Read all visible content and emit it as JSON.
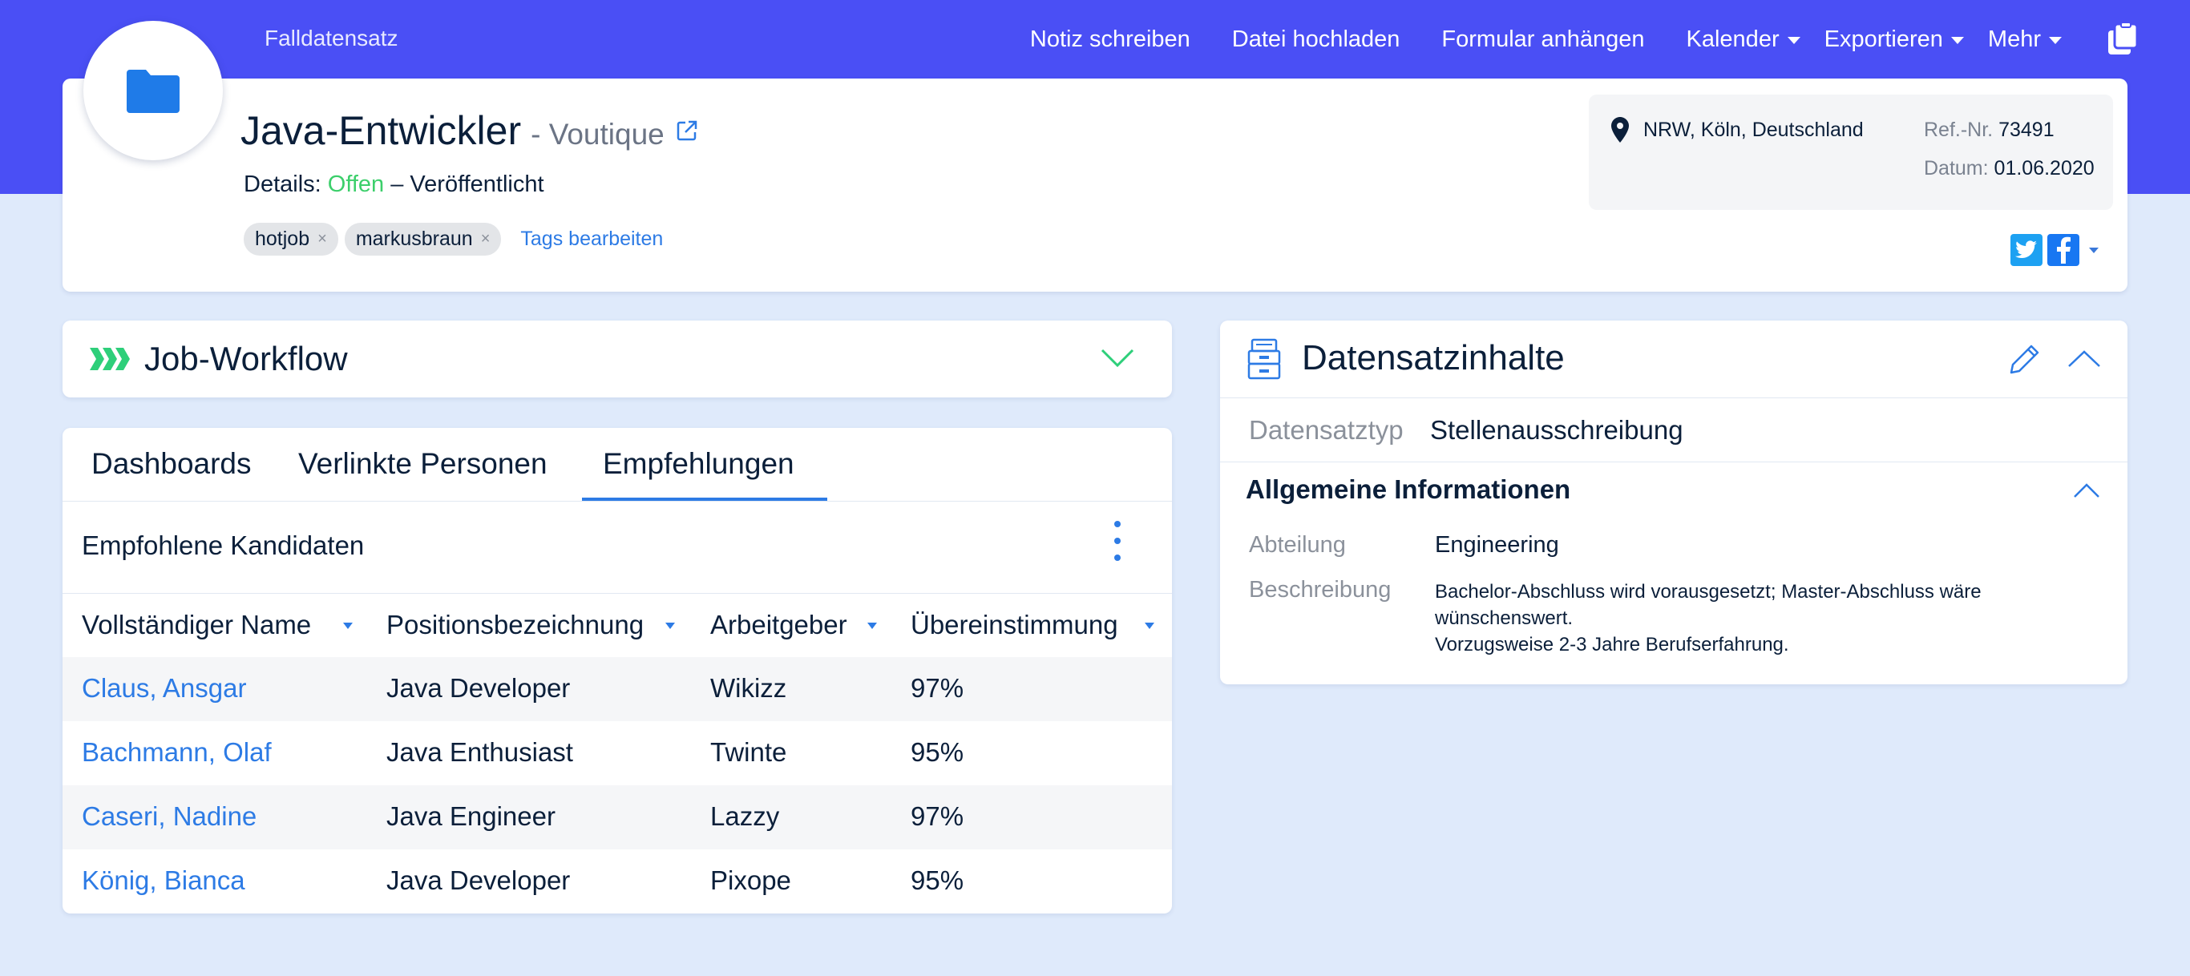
{
  "topbar": {
    "section_label": "Falldatensatz",
    "links": {
      "note": "Notiz schreiben",
      "upload": "Datei hochladen",
      "form": "Formular anhängen",
      "calendar": "Kalender",
      "export": "Exportieren",
      "more": "Mehr"
    }
  },
  "header": {
    "title": "Java-Entwickler",
    "company": "- Voutique",
    "details_label": "Details:",
    "status": "Offen",
    "status_suffix": "– Veröffentlicht",
    "tags": [
      "hotjob",
      "markusbraun"
    ],
    "tags_edit": "Tags bearbeiten",
    "location": "NRW, Köln, Deutschland",
    "ref_label": "Ref.-Nr.",
    "ref_value": "73491",
    "date_label": "Datum:",
    "date_value": "01.06.2020"
  },
  "workflow": {
    "title": "Job-Workflow"
  },
  "tabs": {
    "items": [
      "Dashboards",
      "Verlinkte Personen",
      "Empfehlungen"
    ],
    "active": "Empfehlungen"
  },
  "recommendations": {
    "heading": "Empfohlene Kandidaten",
    "columns": [
      "Vollständiger Name",
      "Positionsbezeichnung",
      "Arbeitgeber",
      "Übereinstimmung"
    ],
    "rows": [
      {
        "name": "Claus, Ansgar",
        "position": "Java Developer",
        "employer": "Wikizz",
        "match": "97%"
      },
      {
        "name": "Bachmann, Olaf",
        "position": "Java Enthusiast",
        "employer": "Twinte",
        "match": "95%"
      },
      {
        "name": "Caseri, Nadine",
        "position": "Java Engineer",
        "employer": "Lazzy",
        "match": "97%"
      },
      {
        "name": "König, Bianca",
        "position": "Java Developer",
        "employer": "Pixope",
        "match": "95%"
      }
    ]
  },
  "contents": {
    "title": "Datensatzinhalte",
    "type_label": "Datensatztyp",
    "type_value": "Stellenausschreibung",
    "general_title": "Allgemeine Informationen",
    "department_label": "Abteilung",
    "department_value": "Engineering",
    "description_label": "Beschreibung",
    "description_lines": [
      "Bachelor-Abschluss wird vorausgesetzt; Master-Abschluss wäre wünschenswert.",
      "Vorzugsweise 2-3 Jahre Berufserfahrung."
    ]
  },
  "colors": {
    "brand": "#4a4ff5",
    "link": "#2d7be5",
    "status_open": "#3ccf6b",
    "workflow_green": "#2ecf7a",
    "twitter": "#1da1f2",
    "facebook": "#1877f2"
  },
  "icons": [
    "folder-icon",
    "external-link-icon",
    "clipboard-icon",
    "location-pin-icon",
    "twitter-icon",
    "facebook-icon",
    "workflow-chevrons-icon",
    "chevron-down-icon",
    "archive-box-icon",
    "pencil-icon",
    "chevron-up-icon",
    "kebab-menu-icon"
  ]
}
